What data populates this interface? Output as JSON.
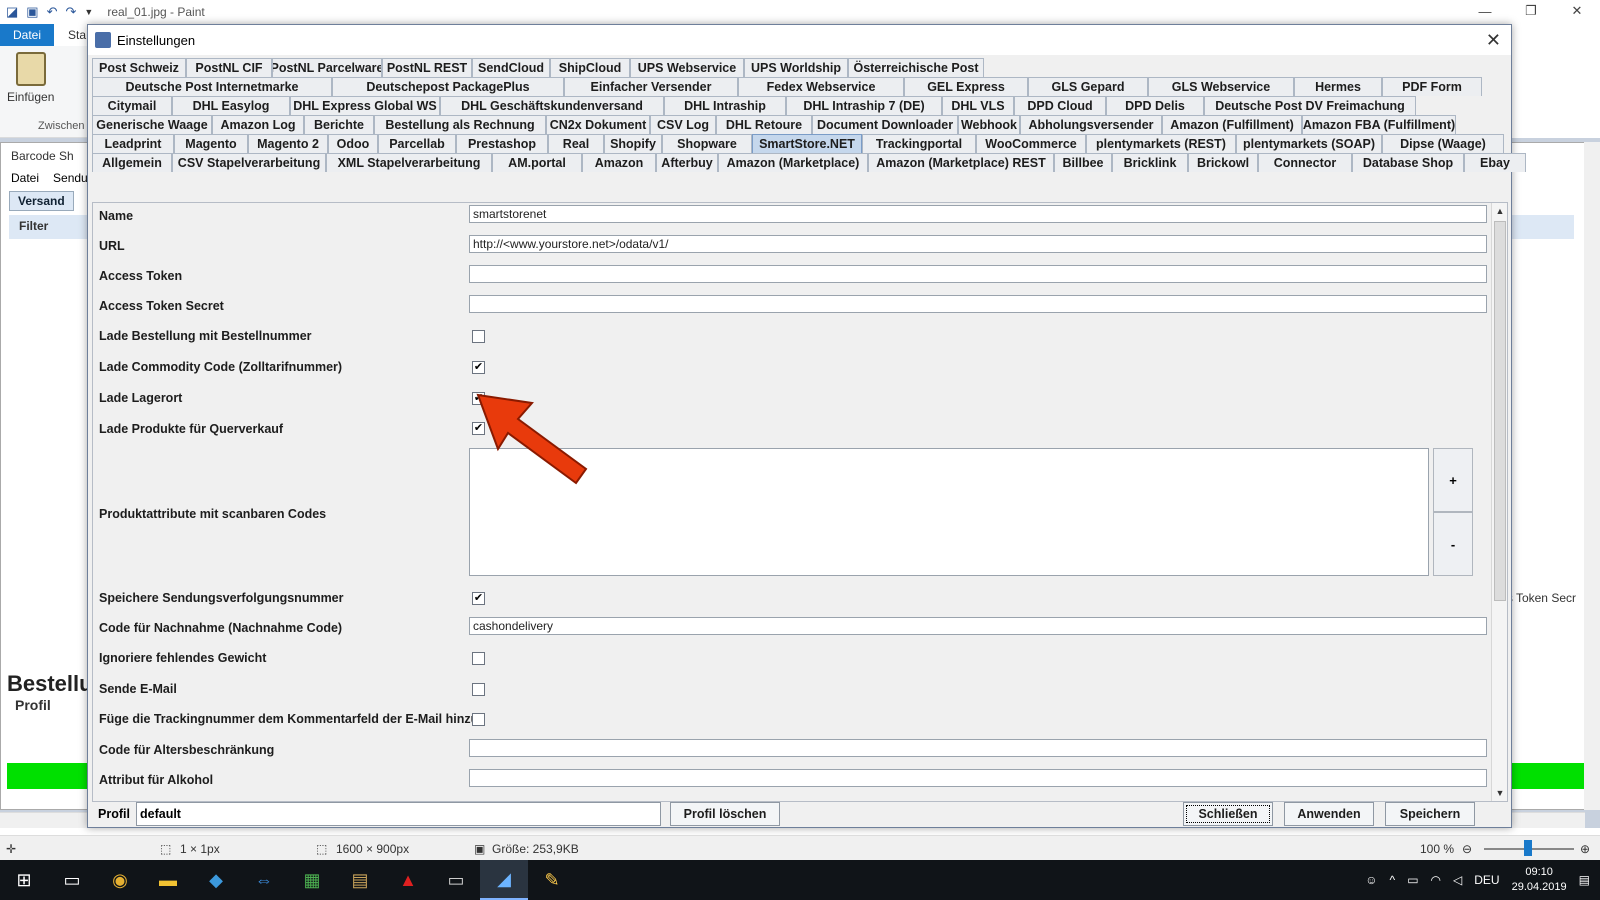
{
  "paint": {
    "title": "real_01.jpg - Paint",
    "tab_file": "Datei",
    "tab_start": "Sta",
    "paste_label": "Einfügen",
    "clipboard_label": "Zwischen",
    "status_pixel": "1 × 1px",
    "status_size": "1600 × 900px",
    "status_filesize": "Größe: 253,9KB",
    "zoom": "100 %"
  },
  "background_app": {
    "title": "Barcode Sh",
    "menu_file": "Datei",
    "menu_send": "Sendu",
    "tab_versand": "Versand",
    "filter_label": "Filter",
    "bestellung_label": "Bestellu",
    "profil_label": "Profil",
    "token_label": "s Token Secr"
  },
  "dialog": {
    "title": "Einstellungen",
    "tab_rows": [
      [
        "Post Schweiz",
        "PostNL CIF",
        "PostNL Parcelware",
        "PostNL REST",
        "SendCloud",
        "ShipCloud",
        "UPS Webservice",
        "UPS Worldship",
        "Österreichische Post"
      ],
      [
        "Deutsche Post Internetmarke",
        "Deutschepost PackagePlus",
        "Einfacher Versender",
        "Fedex Webservice",
        "GEL Express",
        "GLS Gepard",
        "GLS Webservice",
        "Hermes",
        "PDF Form"
      ],
      [
        "Citymail",
        "DHL Easylog",
        "DHL Express Global WS",
        "DHL Geschäftskundenversand",
        "DHL Intraship",
        "DHL Intraship 7 (DE)",
        "DHL VLS",
        "DPD Cloud",
        "DPD Delis",
        "Deutsche Post DV Freimachung"
      ],
      [
        "Generische Waage",
        "Amazon Log",
        "Berichte",
        "Bestellung als Rechnung",
        "CN2x Dokument",
        "CSV Log",
        "DHL Retoure",
        "Document Downloader",
        "Webhook",
        "Abholungsversender",
        "Amazon (Fulfillment)",
        "Amazon FBA (Fulfillment)"
      ],
      [
        "Leadprint",
        "Magento",
        "Magento 2",
        "Odoo",
        "Parcellab",
        "Prestashop",
        "Real",
        "Shopify",
        "Shopware",
        "SmartStore.NET",
        "Trackingportal",
        "WooCommerce",
        "plentymarkets (REST)",
        "plentymarkets (SOAP)",
        "Dipse (Waage)"
      ],
      [
        "Allgemein",
        "CSV Stapelverarbeitung",
        "XML Stapelverarbeitung",
        "AM.portal",
        "Amazon",
        "Afterbuy",
        "Amazon (Marketplace)",
        "Amazon (Marketplace) REST",
        "Billbee",
        "Bricklink",
        "Brickowl",
        "Connector",
        "Database Shop",
        "Ebay"
      ]
    ],
    "selected_tab": "SmartStore.NET",
    "fields": {
      "name_label": "Name",
      "name_value": "smartstorenet",
      "url_label": "URL",
      "url_value": "http://<www.yourstore.net>/odata/v1/",
      "token_label": "Access Token",
      "token_value": "",
      "secret_label": "Access Token Secret",
      "secret_value": "",
      "order_number_label": "Lade Bestellung mit Bestellnummer",
      "order_number_checked": false,
      "commodity_label": "Lade Commodity Code (Zolltarifnummer)",
      "commodity_checked": true,
      "storage_label": "Lade Lagerort",
      "storage_checked": true,
      "crosssell_label": "Lade Produkte für Querverkauf",
      "crosssell_checked": true,
      "attributes_label": "Produktattribute mit scanbaren Codes",
      "plus_label": "+",
      "minus_label": "-",
      "tracking_save_label": "Speichere Sendungsverfolgungsnummer",
      "tracking_save_checked": true,
      "cod_label": "Code für Nachnahme (Nachnahme Code)",
      "cod_value": "cashondelivery",
      "ignore_weight_label": "Ignoriere fehlendes Gewicht",
      "ignore_weight_checked": false,
      "send_email_label": "Sende E-Mail",
      "send_email_checked": false,
      "tracking_comment_label": "Füge die Trackingnummer dem Kommentarfeld der E-Mail hinzu",
      "tracking_comment_checked": false,
      "age_label": "Code für Altersbeschränkung",
      "age_value": "",
      "alcohol_label": "Attribut für Alkohol",
      "alcohol_value": ""
    },
    "bottom": {
      "profile_label": "Profil",
      "profile_value": "default",
      "delete_profile": "Profil löschen",
      "close": "Schließen",
      "apply": "Anwenden",
      "save": "Speichern"
    }
  },
  "taskbar": {
    "language": "DEU",
    "time": "09:10",
    "date": "29.04.2019"
  },
  "icons": [
    "save-icon",
    "undo-icon",
    "redo-icon",
    "close-icon",
    "checkmark-icon",
    "dropdown-arrow-icon",
    "red-arrow-annotation"
  ],
  "colors": {
    "selected_tab": "#c5d7ec",
    "paint_file_tab": "#1979ca",
    "annotation_arrow": "#e83a0c",
    "green_bar": "#00e000"
  }
}
